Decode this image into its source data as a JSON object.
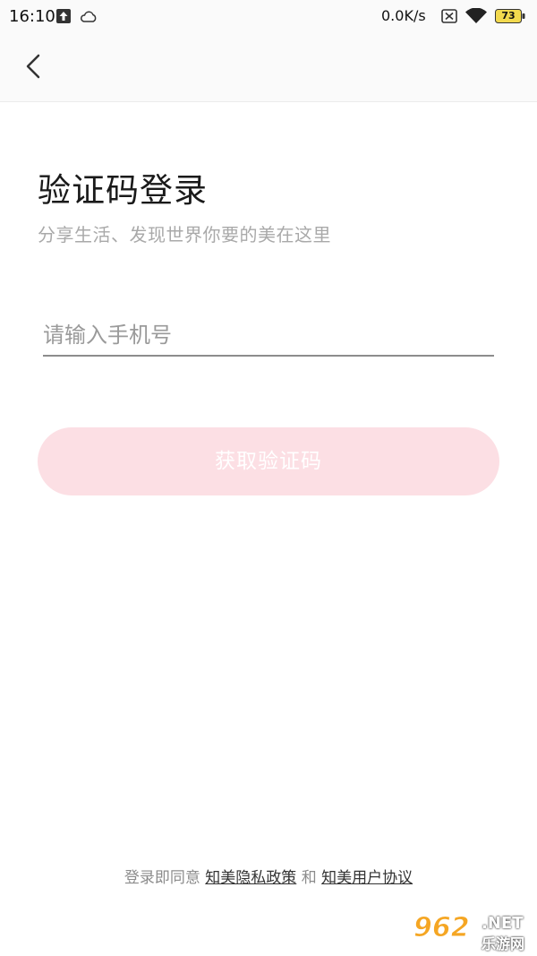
{
  "status_bar": {
    "time": "16:10",
    "network_speed": "0.0K/s",
    "battery_level": "73",
    "icons": [
      "upload-icon",
      "cloud-icon",
      "sim-card-icon",
      "wifi-icon",
      "battery-icon"
    ]
  },
  "header": {
    "back_icon": "chevron-left-icon"
  },
  "main": {
    "title": "验证码登录",
    "subtitle": "分享生活、发现世界你要的美在这里",
    "phone_placeholder": "请输入手机号",
    "get_code_label": "获取验证码"
  },
  "footer": {
    "agree_prefix": "登录即同意",
    "privacy_policy": "知美隐私政策",
    "conjunction": "和",
    "user_agreement": "知美用户协议"
  },
  "watermark": {
    "number": "962",
    "domain": ".NET",
    "site_name": "乐游网"
  },
  "colors": {
    "button_bg": "#fcdfe4",
    "accent_watermark": "#f5a623",
    "header_bg": "#fafafa"
  }
}
